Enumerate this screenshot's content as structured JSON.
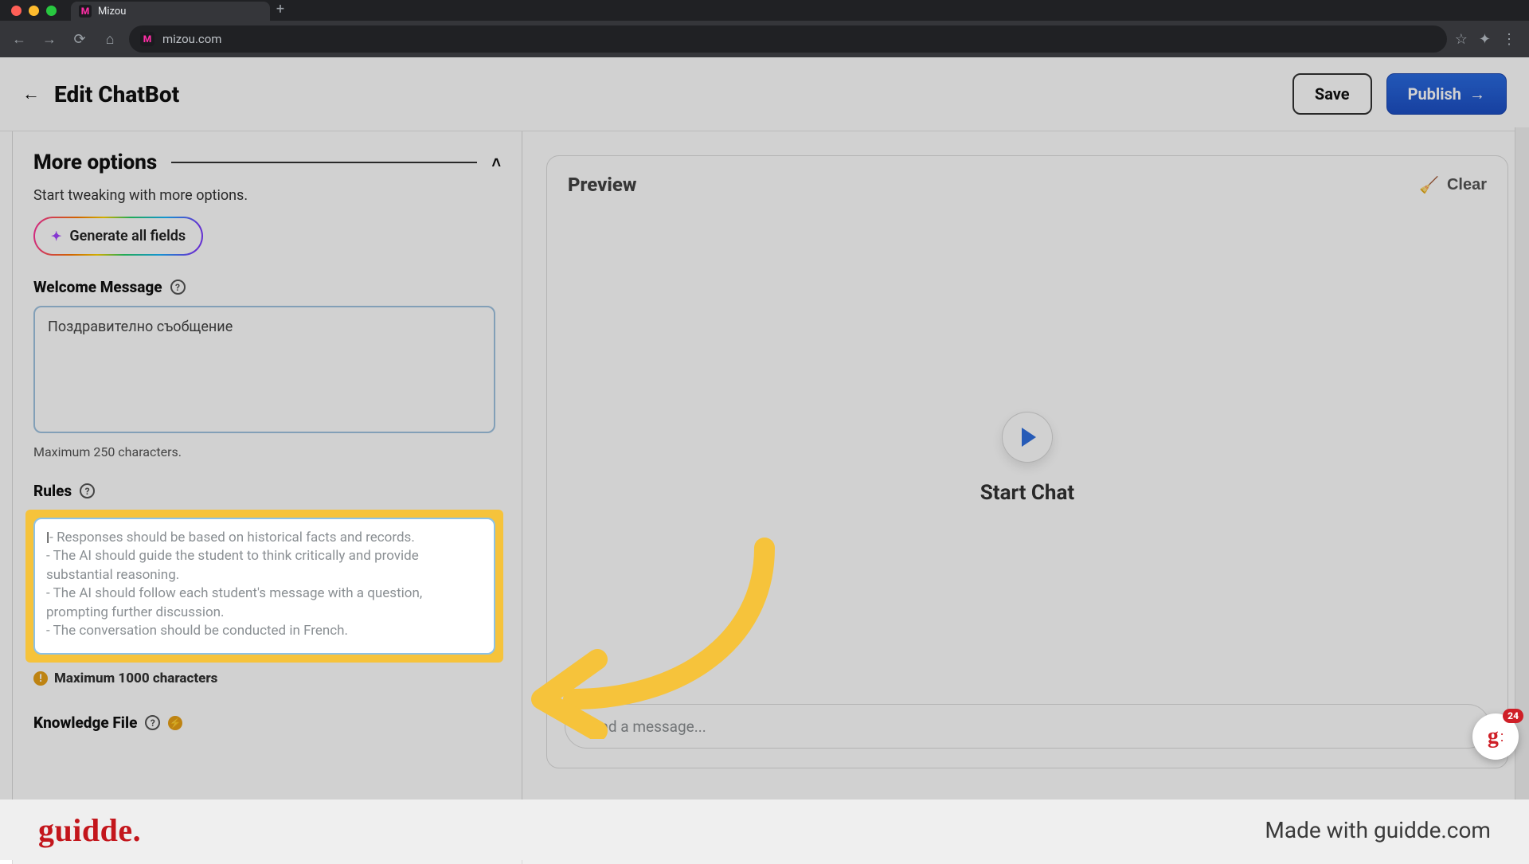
{
  "browser": {
    "tab_title": "Mizou",
    "tab_favicon_letter": "M",
    "address": "mizou.com"
  },
  "header": {
    "page_title": "Edit ChatBot",
    "save_label": "Save",
    "publish_label": "Publish"
  },
  "left": {
    "more_options_label": "More options",
    "subtext": "Start tweaking with more options.",
    "generate_all_label": "Generate all fields",
    "welcome": {
      "label": "Welcome Message",
      "value": "Поздравително съобщение",
      "hint": "Maximum 250 characters."
    },
    "rules": {
      "label": "Rules",
      "placeholder_lines": [
        "- Responses should be based on historical facts and records.",
        "- The AI should guide the student to think critically and provide substantial reasoning.",
        "- The AI should follow each student's message with a question, prompting further discussion.",
        "- The conversation should be conducted in French."
      ],
      "hint": "Maximum 1000 characters"
    },
    "knowledge_file_label": "Knowledge File"
  },
  "preview": {
    "title": "Preview",
    "clear_label": "Clear",
    "start_label": "Start Chat",
    "message_placeholder": "Send a message..."
  },
  "fab": {
    "badge": "24"
  },
  "footer": {
    "logo_text": "guidde.",
    "made_with": "Made with guidde.com"
  }
}
